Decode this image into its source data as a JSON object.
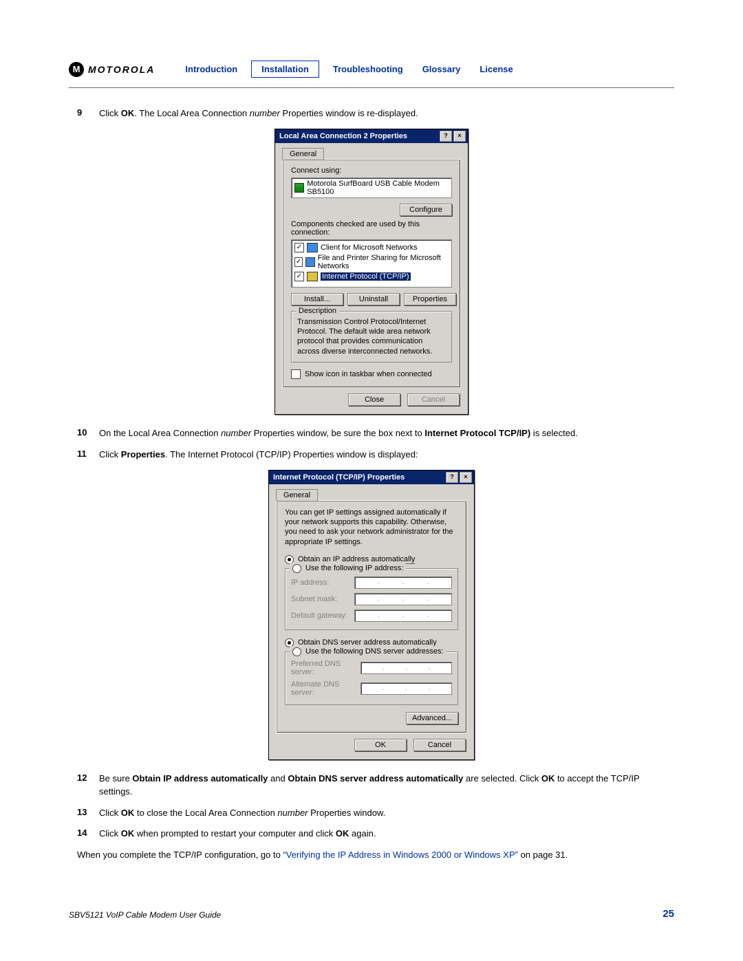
{
  "brand": "MOTOROLA",
  "nav": {
    "intro": "Introduction",
    "install": "Installation",
    "trouble": "Troubleshooting",
    "glossary": "Glossary",
    "license": "License"
  },
  "steps": {
    "s9": {
      "num": "9",
      "pre": "Click ",
      "ok": "OK",
      "post": ". The Local Area Connection ",
      "i": "number",
      "rest": " Properties window is re-displayed."
    },
    "s10": {
      "num": "10",
      "a": "On the Local Area Connection ",
      "i": "number",
      "b": " Properties window, be sure the box next to ",
      "bold": "Internet Protocol TCP/IP)",
      "c": " is selected."
    },
    "s11": {
      "num": "11",
      "a": "Click ",
      "bold": "Properties",
      "b": ". The Internet Protocol (TCP/IP) Properties window is displayed:"
    },
    "s12": {
      "num": "12",
      "a": "Be sure ",
      "b1": "Obtain IP address automatically",
      "mid": " and ",
      "b2": "Obtain DNS server address automatically",
      "c": " are selected. Click ",
      "ok": "OK",
      "d": " to accept the TCP/IP settings."
    },
    "s13": {
      "num": "13",
      "a": "Click ",
      "ok": "OK",
      "b": " to close the Local Area Connection ",
      "i": "number",
      "c": " Properties window."
    },
    "s14": {
      "num": "14",
      "a": "Click ",
      "ok": "OK",
      "b": " when prompted to restart your computer and click ",
      "ok2": "OK",
      "c": " again."
    }
  },
  "closing": {
    "a": "When you complete the TCP/IP configuration, go to ",
    "link": "“Verifying the IP Address in Windows 2000 or Windows XP”",
    "b": " on page 31."
  },
  "dlg1": {
    "title": "Local Area Connection 2 Properties",
    "help": "?",
    "close": "×",
    "tab": "General",
    "connectUsing": "Connect using:",
    "adapter": "Motorola SurfBoard USB Cable Modem SB5100",
    "configure": "Configure",
    "compChecked": "Components checked are used by this connection:",
    "items": {
      "i0": "Client for Microsoft Networks",
      "i1": "File and Printer Sharing for Microsoft Networks",
      "i2": "Internet Protocol (TCP/IP)"
    },
    "install": "Install...",
    "uninstall": "Uninstall",
    "properties": "Properties",
    "descLegend": "Description",
    "descText": "Transmission Control Protocol/Internet Protocol. The default wide area network protocol that provides communication across diverse interconnected networks.",
    "taskbar": "Show icon in taskbar when connected",
    "closeBtn": "Close",
    "cancel": "Cancel"
  },
  "dlg2": {
    "title": "Internet Protocol (TCP/IP) Properties",
    "help": "?",
    "close": "×",
    "tab": "General",
    "para": "You can get IP settings assigned automatically if your network supports this capability. Otherwise, you need to ask your network administrator for the appropriate IP settings.",
    "opt1": "Obtain an IP address automatically",
    "opt2": "Use the following IP address:",
    "ip": "IP address:",
    "mask": "Subnet mask:",
    "gw": "Default gateway:",
    "opt3": "Obtain DNS server address automatically",
    "opt4": "Use the following DNS server addresses:",
    "pdns": "Preferred DNS server:",
    "adns": "Alternate DNS server:",
    "advanced": "Advanced...",
    "ok": "OK",
    "cancel": "Cancel"
  },
  "footer": {
    "guide": "SBV5121 VoIP Cable Modem User Guide",
    "page": "25"
  }
}
